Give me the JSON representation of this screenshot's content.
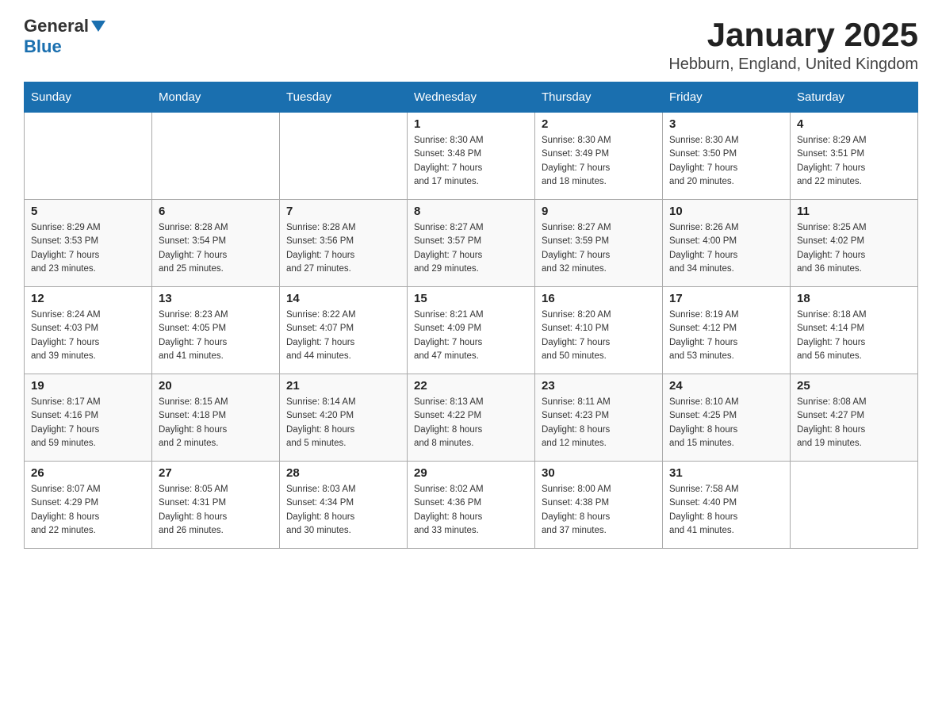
{
  "header": {
    "logo_general": "General",
    "logo_blue": "Blue",
    "title": "January 2025",
    "subtitle": "Hebburn, England, United Kingdom"
  },
  "calendar": {
    "days_of_week": [
      "Sunday",
      "Monday",
      "Tuesday",
      "Wednesday",
      "Thursday",
      "Friday",
      "Saturday"
    ],
    "weeks": [
      [
        {
          "day": "",
          "info": ""
        },
        {
          "day": "",
          "info": ""
        },
        {
          "day": "",
          "info": ""
        },
        {
          "day": "1",
          "info": "Sunrise: 8:30 AM\nSunset: 3:48 PM\nDaylight: 7 hours\nand 17 minutes."
        },
        {
          "day": "2",
          "info": "Sunrise: 8:30 AM\nSunset: 3:49 PM\nDaylight: 7 hours\nand 18 minutes."
        },
        {
          "day": "3",
          "info": "Sunrise: 8:30 AM\nSunset: 3:50 PM\nDaylight: 7 hours\nand 20 minutes."
        },
        {
          "day": "4",
          "info": "Sunrise: 8:29 AM\nSunset: 3:51 PM\nDaylight: 7 hours\nand 22 minutes."
        }
      ],
      [
        {
          "day": "5",
          "info": "Sunrise: 8:29 AM\nSunset: 3:53 PM\nDaylight: 7 hours\nand 23 minutes."
        },
        {
          "day": "6",
          "info": "Sunrise: 8:28 AM\nSunset: 3:54 PM\nDaylight: 7 hours\nand 25 minutes."
        },
        {
          "day": "7",
          "info": "Sunrise: 8:28 AM\nSunset: 3:56 PM\nDaylight: 7 hours\nand 27 minutes."
        },
        {
          "day": "8",
          "info": "Sunrise: 8:27 AM\nSunset: 3:57 PM\nDaylight: 7 hours\nand 29 minutes."
        },
        {
          "day": "9",
          "info": "Sunrise: 8:27 AM\nSunset: 3:59 PM\nDaylight: 7 hours\nand 32 minutes."
        },
        {
          "day": "10",
          "info": "Sunrise: 8:26 AM\nSunset: 4:00 PM\nDaylight: 7 hours\nand 34 minutes."
        },
        {
          "day": "11",
          "info": "Sunrise: 8:25 AM\nSunset: 4:02 PM\nDaylight: 7 hours\nand 36 minutes."
        }
      ],
      [
        {
          "day": "12",
          "info": "Sunrise: 8:24 AM\nSunset: 4:03 PM\nDaylight: 7 hours\nand 39 minutes."
        },
        {
          "day": "13",
          "info": "Sunrise: 8:23 AM\nSunset: 4:05 PM\nDaylight: 7 hours\nand 41 minutes."
        },
        {
          "day": "14",
          "info": "Sunrise: 8:22 AM\nSunset: 4:07 PM\nDaylight: 7 hours\nand 44 minutes."
        },
        {
          "day": "15",
          "info": "Sunrise: 8:21 AM\nSunset: 4:09 PM\nDaylight: 7 hours\nand 47 minutes."
        },
        {
          "day": "16",
          "info": "Sunrise: 8:20 AM\nSunset: 4:10 PM\nDaylight: 7 hours\nand 50 minutes."
        },
        {
          "day": "17",
          "info": "Sunrise: 8:19 AM\nSunset: 4:12 PM\nDaylight: 7 hours\nand 53 minutes."
        },
        {
          "day": "18",
          "info": "Sunrise: 8:18 AM\nSunset: 4:14 PM\nDaylight: 7 hours\nand 56 minutes."
        }
      ],
      [
        {
          "day": "19",
          "info": "Sunrise: 8:17 AM\nSunset: 4:16 PM\nDaylight: 7 hours\nand 59 minutes."
        },
        {
          "day": "20",
          "info": "Sunrise: 8:15 AM\nSunset: 4:18 PM\nDaylight: 8 hours\nand 2 minutes."
        },
        {
          "day": "21",
          "info": "Sunrise: 8:14 AM\nSunset: 4:20 PM\nDaylight: 8 hours\nand 5 minutes."
        },
        {
          "day": "22",
          "info": "Sunrise: 8:13 AM\nSunset: 4:22 PM\nDaylight: 8 hours\nand 8 minutes."
        },
        {
          "day": "23",
          "info": "Sunrise: 8:11 AM\nSunset: 4:23 PM\nDaylight: 8 hours\nand 12 minutes."
        },
        {
          "day": "24",
          "info": "Sunrise: 8:10 AM\nSunset: 4:25 PM\nDaylight: 8 hours\nand 15 minutes."
        },
        {
          "day": "25",
          "info": "Sunrise: 8:08 AM\nSunset: 4:27 PM\nDaylight: 8 hours\nand 19 minutes."
        }
      ],
      [
        {
          "day": "26",
          "info": "Sunrise: 8:07 AM\nSunset: 4:29 PM\nDaylight: 8 hours\nand 22 minutes."
        },
        {
          "day": "27",
          "info": "Sunrise: 8:05 AM\nSunset: 4:31 PM\nDaylight: 8 hours\nand 26 minutes."
        },
        {
          "day": "28",
          "info": "Sunrise: 8:03 AM\nSunset: 4:34 PM\nDaylight: 8 hours\nand 30 minutes."
        },
        {
          "day": "29",
          "info": "Sunrise: 8:02 AM\nSunset: 4:36 PM\nDaylight: 8 hours\nand 33 minutes."
        },
        {
          "day": "30",
          "info": "Sunrise: 8:00 AM\nSunset: 4:38 PM\nDaylight: 8 hours\nand 37 minutes."
        },
        {
          "day": "31",
          "info": "Sunrise: 7:58 AM\nSunset: 4:40 PM\nDaylight: 8 hours\nand 41 minutes."
        },
        {
          "day": "",
          "info": ""
        }
      ]
    ]
  }
}
